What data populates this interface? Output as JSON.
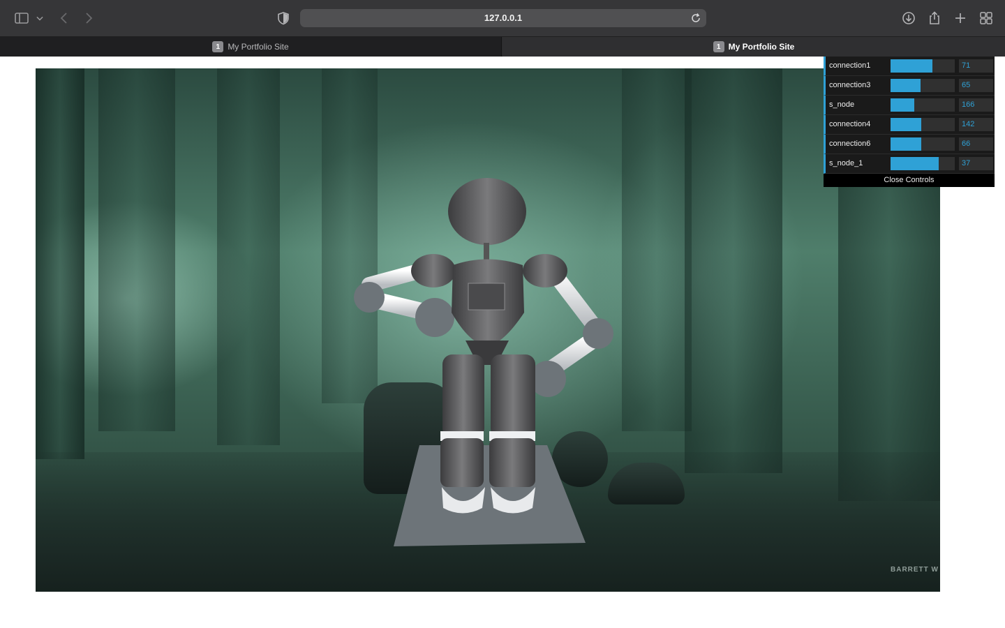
{
  "browser": {
    "url": "127.0.0.1",
    "icons": {
      "sidebar": "sidebar-icon",
      "chevron": "chevron-down-icon",
      "back": "back-arrow-icon",
      "forward": "forward-arrow-icon",
      "privacy": "shield-icon",
      "reload": "reload-icon",
      "download": "download-icon",
      "share": "share-icon",
      "new_tab": "plus-icon",
      "tab_overview": "grid-icon"
    }
  },
  "tabs": [
    {
      "badge": "1",
      "title": "My Portfolio Site",
      "active": false
    },
    {
      "badge": "1",
      "title": "My Portfolio Site",
      "active": true
    }
  ],
  "controls": {
    "accent": "#2fa1d6",
    "rows": [
      {
        "label": "connection1",
        "value": "71",
        "fill": 0.65
      },
      {
        "label": "connection3",
        "value": "65",
        "fill": 0.47
      },
      {
        "label": "s_node",
        "value": "166",
        "fill": 0.37
      },
      {
        "label": "connection4",
        "value": "142",
        "fill": 0.48
      },
      {
        "label": "connection6",
        "value": "66",
        "fill": 0.48
      },
      {
        "label": "s_node_1",
        "value": "37",
        "fill": 0.75
      }
    ],
    "close_label": "Close Controls"
  },
  "scene": {
    "watermark": "BARRETT W"
  }
}
